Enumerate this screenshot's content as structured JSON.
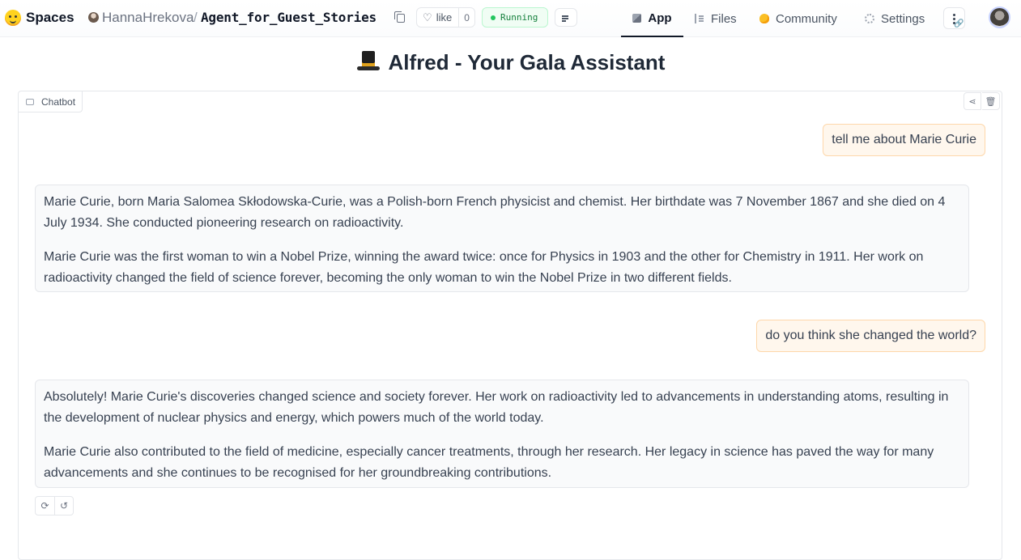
{
  "header": {
    "brand": "Spaces",
    "owner": "HannaHrekova",
    "separator": "/",
    "repo": "Agent_for_Guest_Stories",
    "like_label": "like",
    "like_count": "0",
    "status": "Running",
    "status_color": "#22c55e",
    "tabs": [
      {
        "label": "App",
        "icon": "cube-icon",
        "active": true
      },
      {
        "label": "Files",
        "icon": "files-icon",
        "active": false
      },
      {
        "label": "Community",
        "icon": "community-icon",
        "active": false
      },
      {
        "label": "Settings",
        "icon": "gear-icon",
        "active": false
      }
    ]
  },
  "app": {
    "title": "Alfred - Your Gala Assistant",
    "title_icon": "top-hat-icon",
    "chatbot_label": "Chatbot",
    "messages": [
      {
        "role": "user",
        "text": "tell me about Marie Curie"
      },
      {
        "role": "assistant",
        "paragraphs": [
          "Marie Curie, born Maria Salomea Skłodowska-Curie, was a Polish-born French physicist and chemist. Her birthdate was 7 November 1867 and she died on 4 July 1934. She conducted pioneering research on radioactivity.",
          "Marie Curie was the first woman to win a Nobel Prize, winning the award twice: once for Physics in 1903 and the other for Chemistry in 1911. Her work on radioactivity changed the field of science forever, becoming the only woman to win the Nobel Prize in two different fields."
        ]
      },
      {
        "role": "user",
        "text": "do you think she changed the world?"
      },
      {
        "role": "assistant",
        "paragraphs": [
          "Absolutely! Marie Curie's discoveries changed science and society forever. Her work on radioactivity led to advancements in understanding atoms, resulting in the development of nuclear physics and energy, which powers much of the world today.",
          "Marie Curie also contributed to the field of medicine, especially cancer treatments, through her research. Her legacy in science has paved the way for many advancements and she continues to be recognised for her groundbreaking contributions."
        ]
      }
    ],
    "actions": [
      "retry-icon",
      "undo-icon"
    ]
  }
}
